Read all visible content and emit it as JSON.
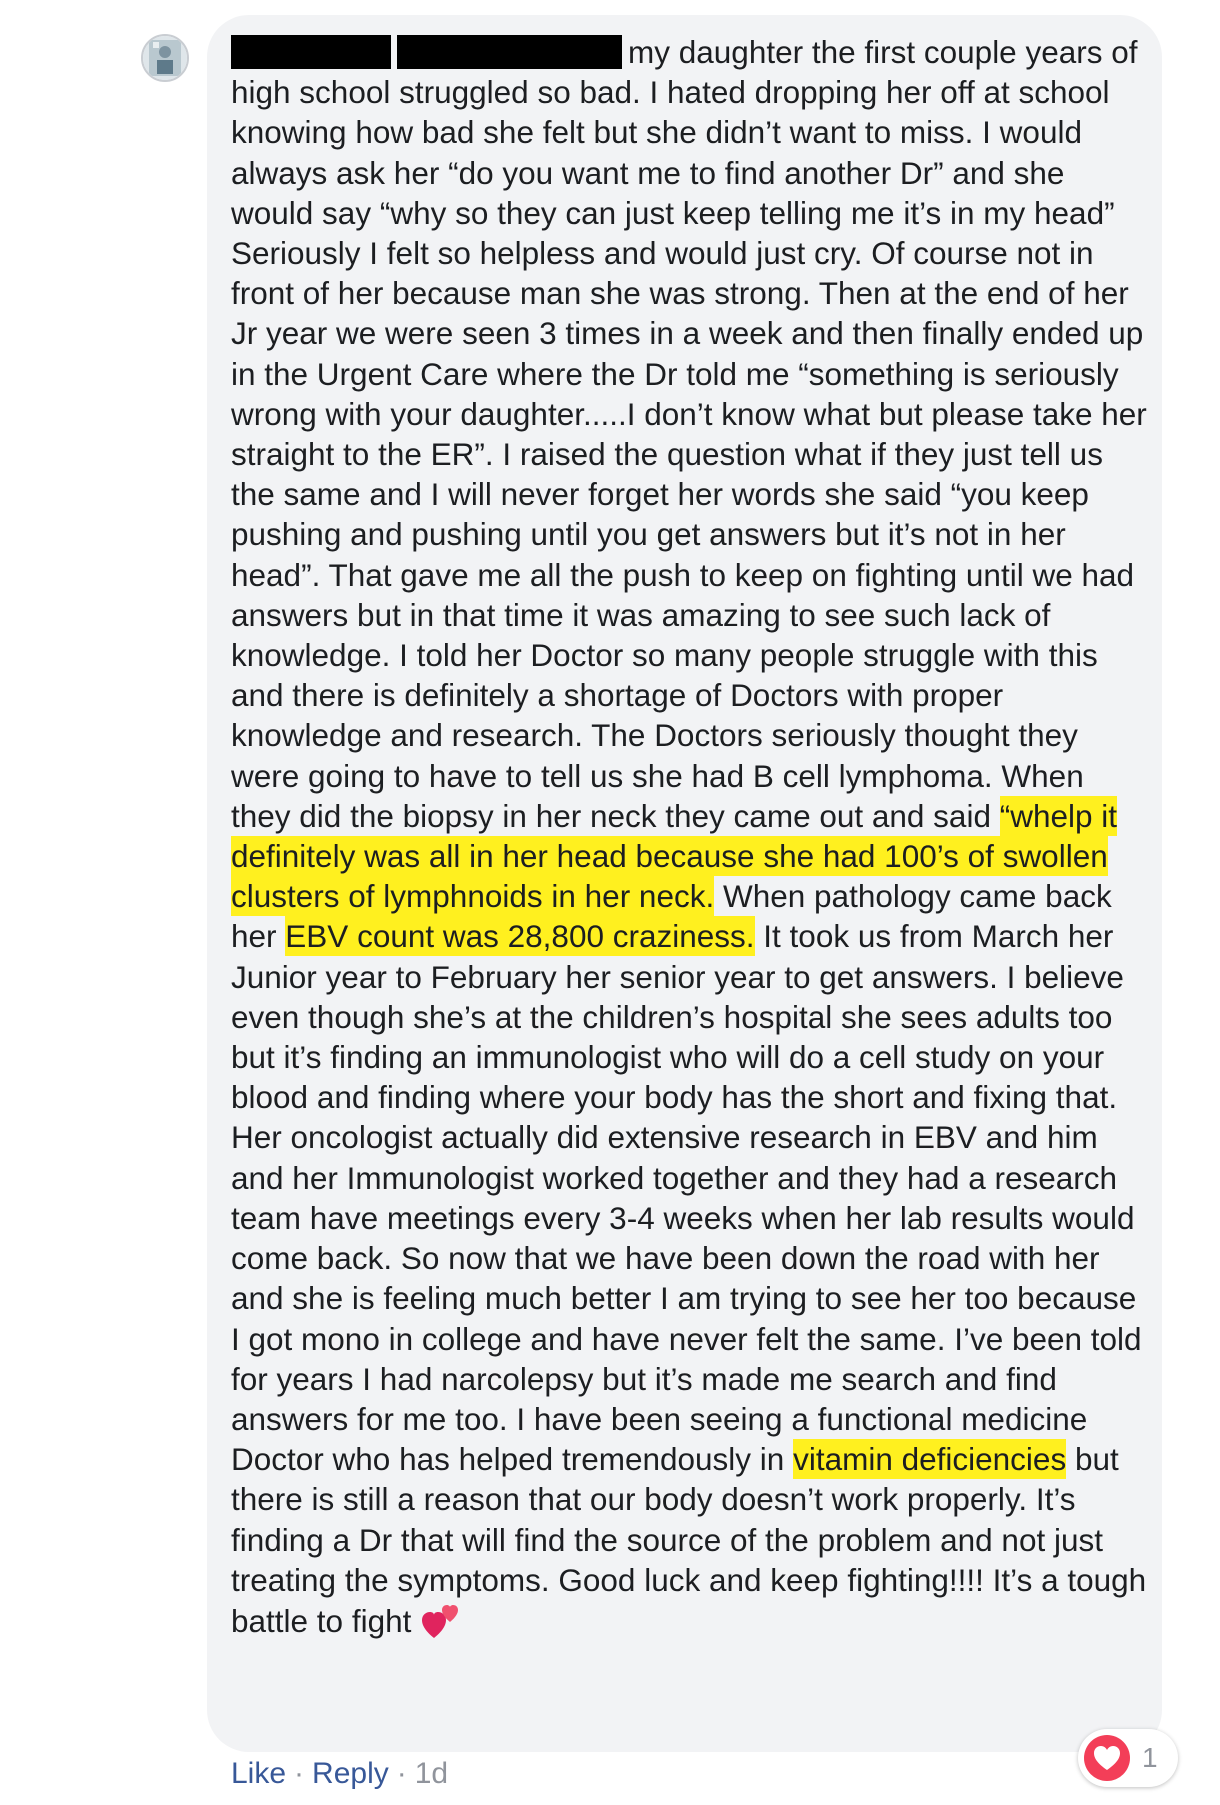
{
  "comment": {
    "avatar_icon": "user-avatar-photo",
    "segments": [
      {
        "t": "my daughter the first couple years of high school struggled so bad. I hated dropping her off at school knowing how bad she felt but she didn’t want to miss. I would always ask her “do you want me to find another Dr” and she would say “why so they can just keep telling me it’s in my head” Seriously I felt so helpless and would just cry. Of course not in front of her because man she was strong. Then at the end of her Jr year we were seen 3 times in a week and then finally ended up in the Urgent Care where the Dr told me “something is seriously wrong with your daughter.....I don’t know what but please take her straight to the ER”. I raised the question what if they just tell us the same and I will never forget her words she said “you keep pushing and pushing until you get answers but it’s not in her head”. That gave me all the push to keep on fighting until we had answers but in that time it was amazing to see such lack of knowledge. I told her Doctor so many people struggle with this and there is definitely a shortage of Doctors with proper knowledge and research. The Doctors seriously thought they were going to have to tell us she had B cell lymphoma. When they did the biopsy in her neck they came out and said "
      },
      {
        "t": "“whelp it definitely was all in her head because she had 100’s of swollen clusters of lymphnoids in her neck."
      },
      {
        "t": " When pathology came back her "
      },
      {
        "t": "EBV count was 28,800 craziness."
      },
      {
        "t": " It took us from March her Junior year to February her senior year to get answers. I believe even though she’s at the children’s hospital she sees adults too but it’s finding an immunologist who will do a cell study on your blood and finding where your body has the short and fixing that. Her oncologist actually did extensive research in EBV and him and her Immunologist worked together and they had a research team have meetings every 3-4 weeks when her lab results would come back. So now that we have been down the road with her and she is feeling much better I am trying to see her too because I got mono in college and have never felt the same. I’ve been told for years I had narcolepsy but it’s made me search and find answers for me too. I have been seeing a functional medicine Doctor who has helped tremendously in "
      },
      {
        "t": "vitamin deficiencies"
      },
      {
        "t": " but there is still a reason that our body doesn’t work properly. It’s finding a Dr that will find the source of the problem and not just treating the symptoms. Good luck and keep fighting!!!! It’s a tough battle to fight "
      }
    ],
    "emoji_icon": "two-hearts-icon",
    "highlight_color": "#fff01f"
  },
  "actions": {
    "like_label": "Like",
    "separator": "·",
    "reply_label": "Reply",
    "time_label": "1d"
  },
  "reactions": {
    "icon": "love-reaction-icon",
    "count": "1"
  }
}
